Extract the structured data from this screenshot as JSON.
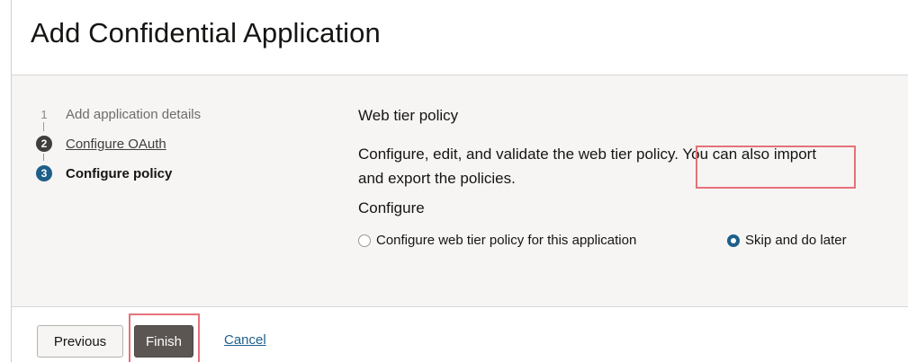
{
  "header": {
    "title": "Add Confidential Application"
  },
  "steps": [
    {
      "number": "1",
      "label": "Add application details",
      "state": "pending"
    },
    {
      "number": "2",
      "label": "Configure OAuth",
      "state": "done"
    },
    {
      "number": "3",
      "label": "Configure policy",
      "state": "current"
    }
  ],
  "main": {
    "section_title": "Web tier policy",
    "description": "Configure, edit, and validate the web tier policy. You can also import and export the policies.",
    "configure_label": "Configure",
    "radio_options": [
      {
        "label": "Configure web tier policy for this application",
        "selected": false
      },
      {
        "label": "Skip and do later",
        "selected": true
      }
    ]
  },
  "footer": {
    "previous_label": "Previous",
    "finish_label": "Finish",
    "cancel_label": "Cancel"
  },
  "colors": {
    "accent": "#1d5f8a",
    "highlight": "#e5727a",
    "finish_button": "#5b5652",
    "body_background": "#f6f5f3"
  }
}
